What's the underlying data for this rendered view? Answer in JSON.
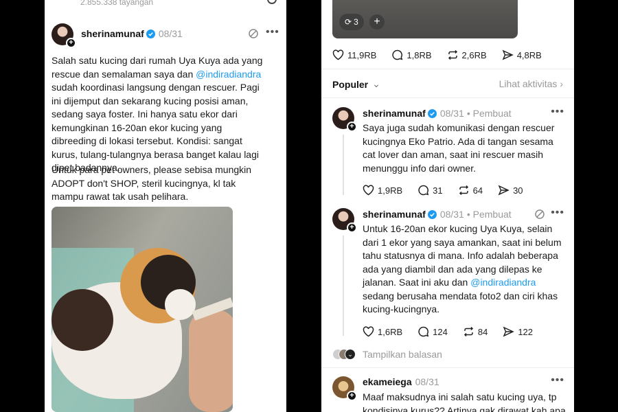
{
  "left": {
    "views": "2.855.338 tayangan",
    "post": {
      "username": "sherinamunaf",
      "date": "08/31",
      "text_1": "Salah satu kucing dari rumah Uya Kuya ada yang rescue dan semalaman saya dan ",
      "mention": "@indiradiandra",
      "text_2": " sudah koordinasi langsung dengan rescuer. Pagi ini dijemput dan sekarang kucing posisi aman, sedang saya foster. Ini hanya satu ekor dari kemungkinan 16-20an ekor kucing yang dibreeding di lokasi tersebut. Kondisi: sangat kurus, tulang-tulangnya berasa banget kalau lagi dipet badannya.",
      "paragraph_2": "Untuk para pet owners, please sebisa mungkin ADOPT don't SHOP, steril kucingnya, kl tak mampu rawat tak usah pelihara."
    }
  },
  "right": {
    "media_count": "3",
    "stats": {
      "likes": "11,9RB",
      "comments": "1,8RB",
      "reposts": "2,6RB",
      "shares": "4,8RB"
    },
    "sort_label": "Populer",
    "activity_link": "Lihat aktivitas",
    "replies": [
      {
        "username": "sherinamunaf",
        "date": "08/31",
        "role": "• Pembuat",
        "text": "Saya juga sudah komunikasi dengan rescuer kucingnya Eko Patrio. Ada di tangan sesama cat lover dan aman, saat ini rescuer masih menunggu info dari owner.",
        "likes": "1,9RB",
        "comments": "31",
        "reposts": "64",
        "shares": "30"
      },
      {
        "username": "sherinamunaf",
        "date": "08/31",
        "role": "• Pembuat",
        "text_1": "Untuk 16-20an ekor kucing Uya Kuya, selain dari 1 ekor yang saya amankan, saat ini belum tahu statusnya di mana. Info adalah beberapa ada yang diambil dan ada yang dilepas ke jalanan. Saat ini aku dan ",
        "mention": "@indiradiandra",
        "text_2": " sedang berusaha mendata foto2 dan ciri khas kucing-kucingnya.",
        "likes": "1,6RB",
        "comments": "124",
        "reposts": "84",
        "shares": "122"
      }
    ],
    "show_replies": "Tampilkan balasan",
    "third_reply": {
      "username": "ekameiega",
      "date": "08/31",
      "text": "Maaf maksudnya ini salah satu kucing uya, tp kondisinya kurus?? Artinya gak dirawat kah apa"
    }
  }
}
